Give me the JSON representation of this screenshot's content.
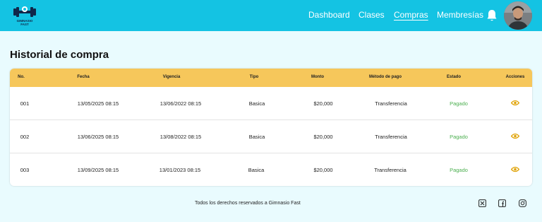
{
  "brand": {
    "logo_text": "GIMNASIO FAST"
  },
  "nav": {
    "links": [
      {
        "label": "Dashboard",
        "active": false
      },
      {
        "label": "Clases",
        "active": false
      },
      {
        "label": "Compras",
        "active": true
      },
      {
        "label": "Membresías",
        "active": false
      }
    ]
  },
  "page": {
    "title": "Historial de compra"
  },
  "table": {
    "headers": [
      "No.",
      "Fecha",
      "Vigencia",
      "Tipo",
      "Monto",
      "Método de pago",
      "Estado",
      "Acciones"
    ],
    "rows": [
      {
        "no": "001",
        "fecha": "13/05/2025 08:15",
        "vigencia": "13/06/2022 08:15",
        "tipo": "Basica",
        "monto": "$20,000",
        "metodo": "Transferencia",
        "estado": "Pagado"
      },
      {
        "no": "002",
        "fecha": "13/06/2025 08:15",
        "vigencia": "13/08/2022 08:15",
        "tipo": "Basica",
        "monto": "$20,000",
        "metodo": "Transferencia",
        "estado": "Pagado"
      },
      {
        "no": "003",
        "fecha": "13/09/2025 08:15",
        "vigencia": "13/01/2023 08:15",
        "tipo": "Basica",
        "monto": "$20,000",
        "metodo": "Transferencia",
        "estado": "Pagado"
      }
    ]
  },
  "footer": {
    "text": "Todos los derechos reservados a Gimnasio Fast",
    "social_icons": [
      "x-twitter-icon",
      "facebook-icon",
      "instagram-icon"
    ]
  },
  "colors": {
    "navbar": "#14c3e3",
    "page_bg": "#e9fbfe",
    "table_header": "#f6c75b",
    "status_paid": "#4caf50",
    "action_icon": "#e0a40a"
  }
}
